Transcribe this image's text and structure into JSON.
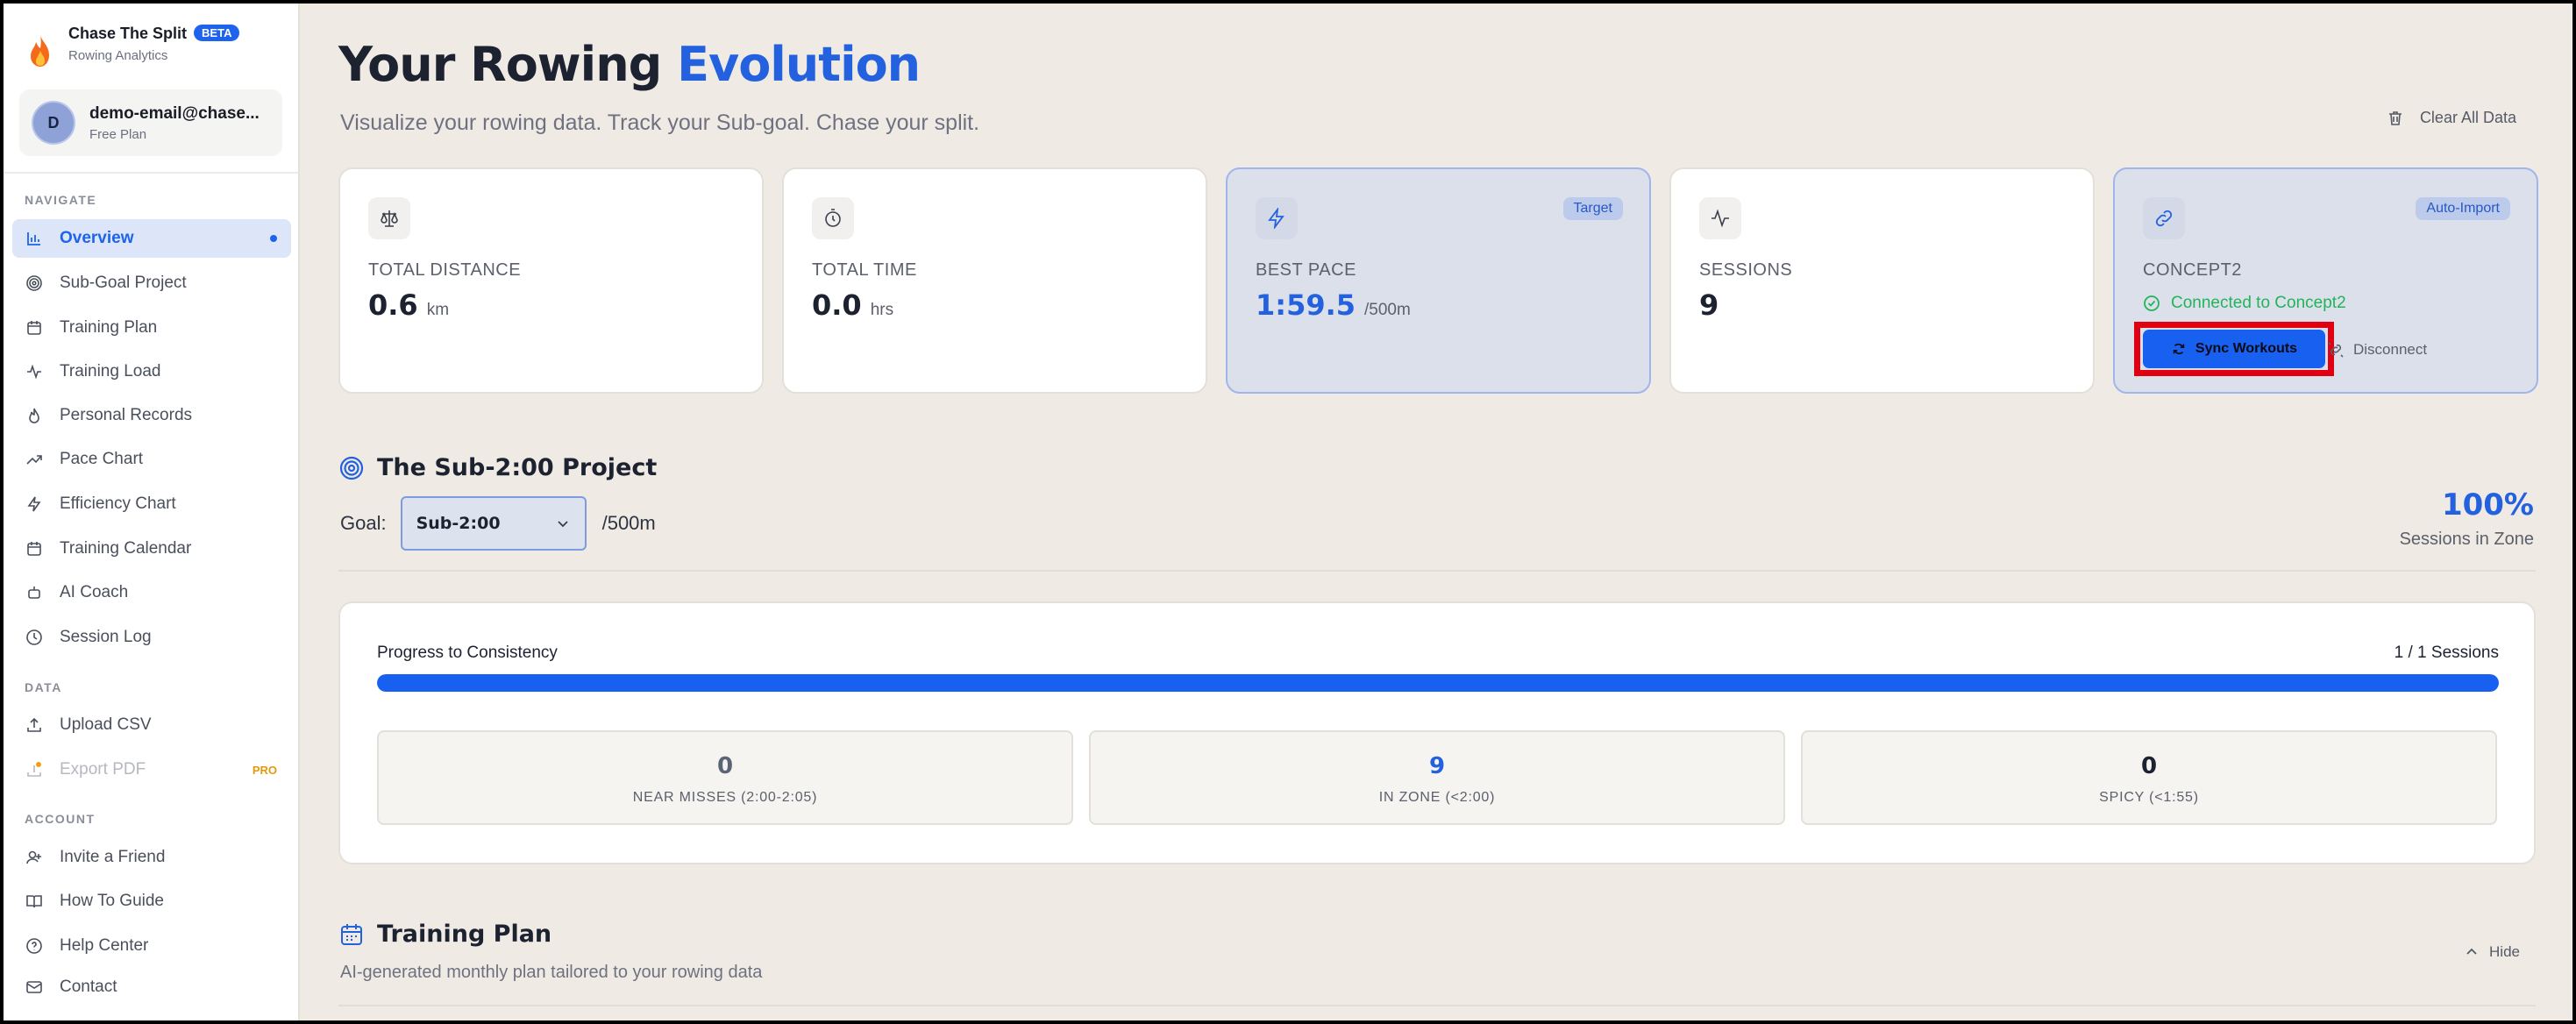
{
  "brand": {
    "name": "Chase The Split",
    "badge": "BETA",
    "subtitle": "Rowing Analytics"
  },
  "user": {
    "initial": "D",
    "email": "demo-email@chase...",
    "plan": "Free Plan"
  },
  "sidebar": {
    "sections": {
      "navigate": "NAVIGATE",
      "data": "DATA",
      "account": "ACCOUNT"
    },
    "navigate": [
      {
        "label": "Overview",
        "icon": "bar-chart-icon"
      },
      {
        "label": "Sub-Goal Project",
        "icon": "target-icon"
      },
      {
        "label": "Training Plan",
        "icon": "calendar-icon"
      },
      {
        "label": "Training Load",
        "icon": "activity-icon"
      },
      {
        "label": "Personal Records",
        "icon": "flame-icon"
      },
      {
        "label": "Pace Chart",
        "icon": "trending-up-icon"
      },
      {
        "label": "Efficiency Chart",
        "icon": "zap-icon"
      },
      {
        "label": "Training Calendar",
        "icon": "calendar-icon"
      },
      {
        "label": "AI Coach",
        "icon": "bot-icon"
      },
      {
        "label": "Session Log",
        "icon": "clock-icon"
      }
    ],
    "data": [
      {
        "label": "Upload CSV",
        "icon": "upload-icon"
      },
      {
        "label": "Export PDF",
        "icon": "export-icon",
        "badge": "PRO"
      }
    ],
    "account": [
      {
        "label": "Invite a Friend",
        "icon": "user-plus-icon"
      },
      {
        "label": "How To Guide",
        "icon": "book-icon"
      },
      {
        "label": "Help Center",
        "icon": "help-circle-icon"
      },
      {
        "label": "Contact",
        "icon": "mail-icon"
      }
    ]
  },
  "header": {
    "title_prefix": "Your Rowing",
    "title_accent": "Evolution",
    "subtitle": "Visualize your rowing data. Track your Sub-goal. Chase your split.",
    "clear_label": "Clear All Data"
  },
  "cards": {
    "distance": {
      "label": "TOTAL DISTANCE",
      "value": "0.6",
      "unit": "km",
      "icon": "scale-icon"
    },
    "time": {
      "label": "TOTAL TIME",
      "value": "0.0",
      "unit": "hrs",
      "icon": "timer-icon"
    },
    "pace": {
      "label": "BEST PACE",
      "value": "1:59.5",
      "unit": "/500m",
      "tag": "Target",
      "icon": "zap-icon"
    },
    "sessions": {
      "label": "SESSIONS",
      "value": "9",
      "icon": "activity-icon"
    },
    "concept2": {
      "label": "CONCEPT2",
      "tag": "Auto-Import",
      "status": "Connected to Concept2",
      "sync_label": "Sync Workouts",
      "disconnect_label": "Disconnect",
      "icon": "link-icon"
    }
  },
  "subgoal": {
    "title": "The Sub-2:00 Project",
    "goal_label": "Goal:",
    "goal_value": "Sub-2:00",
    "goal_unit": "/500m",
    "percent": "100%",
    "percent_label": "Sessions in Zone"
  },
  "progress": {
    "title": "Progress to Consistency",
    "count": "1 / 1 Sessions",
    "fraction": 1.0,
    "stats": [
      {
        "value": "0",
        "label": "NEAR MISSES (2:00-2:05)"
      },
      {
        "value": "9",
        "label": "IN ZONE (<2:00)"
      },
      {
        "value": "0",
        "label": "SPICY (<1:55)"
      }
    ]
  },
  "training_plan": {
    "title": "Training Plan",
    "subtitle": "AI-generated monthly plan tailored to your rowing data",
    "hide_label": "Hide"
  },
  "colors": {
    "accent": "#1760f0",
    "success": "#22b45a",
    "highlight": "#e00012",
    "pro": "#e59a0c"
  }
}
